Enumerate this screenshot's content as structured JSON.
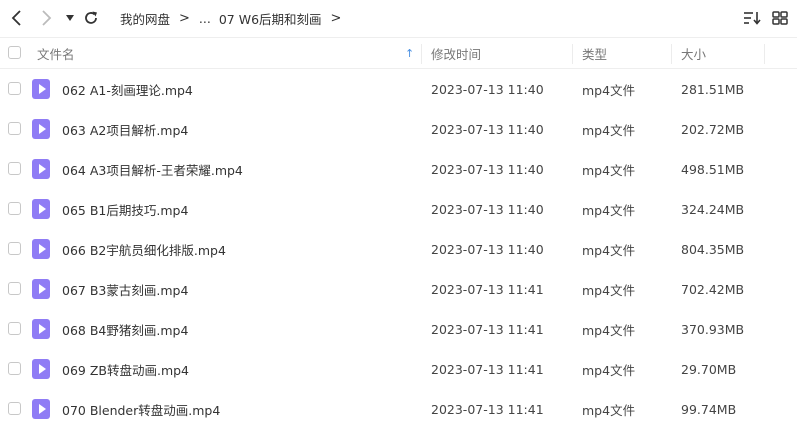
{
  "toolbar": {
    "back_icon": "chevron-left-icon",
    "forward_icon": "chevron-right-icon",
    "dropdown_icon": "caret-down-icon",
    "refresh_icon": "refresh-icon",
    "sort_icon": "sort-list-icon",
    "grid_icon": "grid-view-icon"
  },
  "breadcrumb": {
    "root": "我的网盘",
    "sep1": ">",
    "ellipsis": "...",
    "current": "07 W6后期和刻画",
    "sep2": ">"
  },
  "columns": {
    "name": "文件名",
    "sort_indicator": "↑",
    "modified": "修改时间",
    "type": "类型",
    "size": "大小"
  },
  "colors": {
    "accent": "#4a90e2",
    "video_icon": "#8f7cf5"
  },
  "files": [
    {
      "name": "062 A1-刻画理论.mp4",
      "modified": "2023-07-13 11:40",
      "type": "mp4文件",
      "size": "281.51MB"
    },
    {
      "name": "063 A2项目解析.mp4",
      "modified": "2023-07-13 11:40",
      "type": "mp4文件",
      "size": "202.72MB"
    },
    {
      "name": "064 A3项目解析-王者荣耀.mp4",
      "modified": "2023-07-13 11:40",
      "type": "mp4文件",
      "size": "498.51MB"
    },
    {
      "name": "065 B1后期技巧.mp4",
      "modified": "2023-07-13 11:40",
      "type": "mp4文件",
      "size": "324.24MB"
    },
    {
      "name": "066 B2宇航员细化排版.mp4",
      "modified": "2023-07-13 11:40",
      "type": "mp4文件",
      "size": "804.35MB"
    },
    {
      "name": "067 B3蒙古刻画.mp4",
      "modified": "2023-07-13 11:41",
      "type": "mp4文件",
      "size": "702.42MB"
    },
    {
      "name": "068 B4野猪刻画.mp4",
      "modified": "2023-07-13 11:41",
      "type": "mp4文件",
      "size": "370.93MB"
    },
    {
      "name": "069 ZB转盘动画.mp4",
      "modified": "2023-07-13 11:41",
      "type": "mp4文件",
      "size": "29.70MB"
    },
    {
      "name": "070 Blender转盘动画.mp4",
      "modified": "2023-07-13 11:41",
      "type": "mp4文件",
      "size": "99.74MB"
    }
  ]
}
